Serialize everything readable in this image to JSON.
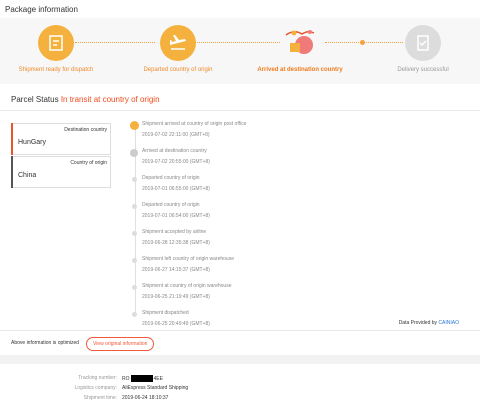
{
  "page_title": "Package information",
  "steps": [
    {
      "label": "Shipment ready for dispatch",
      "icon": "package-icon",
      "state": "done"
    },
    {
      "label": "Departed country of origin",
      "icon": "plane-icon",
      "state": "done"
    },
    {
      "label": "Arrived at destination country",
      "icon": "destination-icon",
      "state": "active"
    },
    {
      "label": "Delivery successful",
      "icon": "clipboard-check-icon",
      "state": "pending"
    }
  ],
  "parcel_status": {
    "label": "Parcel Status",
    "value": "In transit at country of origin"
  },
  "destination": {
    "label": "Destination country",
    "name": "HunGary",
    "color": "#e8552a"
  },
  "origin": {
    "label": "Country of origin",
    "name": "China",
    "color": "#555555"
  },
  "events": [
    {
      "text": "Shipment arrived at country of origin post office",
      "time": "2019-07-02 22:11:00 (GMT+8)"
    },
    {
      "text": "Arrived at destination country",
      "time": "2019-07-02 20:55:00 (GMT+8)"
    },
    {
      "text": "Departed country of origin",
      "time": "2019-07-01 06:55:00 (GMT+8)"
    },
    {
      "text": "Departed country of origin",
      "time": "2019-07-01 06:54:00 (GMT+8)"
    },
    {
      "text": "Shipment accepted by airline",
      "time": "2019-06-28 12:35:38 (GMT+8)"
    },
    {
      "text": "Shipment left country of origin warehouse",
      "time": "2019-06-27 14:15:37 (GMT+8)"
    },
    {
      "text": "Shipment at country of origin warehouse",
      "time": "2019-06-25 21:19:49 (GMT+8)"
    },
    {
      "text": "Shipment dispatched",
      "time": "2019-06-25 20:49:49 (GMT+8)"
    }
  ],
  "provided_by": {
    "prefix": "Data Provided by",
    "link": "CAINIAO"
  },
  "optimized_note": "Above information is optimized",
  "view_original_label": "View original information",
  "info": {
    "tracking_label": "Tracking number:",
    "tracking_prefix": "RO",
    "tracking_suffix": "4EE",
    "logistics_label": "Logistics company:",
    "logistics_value": "AliExpress Standard Shipping",
    "shipment_time_label": "Shipment time:",
    "shipment_time_value": "2019-06-24  18:10:37"
  },
  "colors": {
    "accent": "#f5b13d",
    "status_red": "#f04c1c",
    "link_blue": "#2b76d6"
  }
}
